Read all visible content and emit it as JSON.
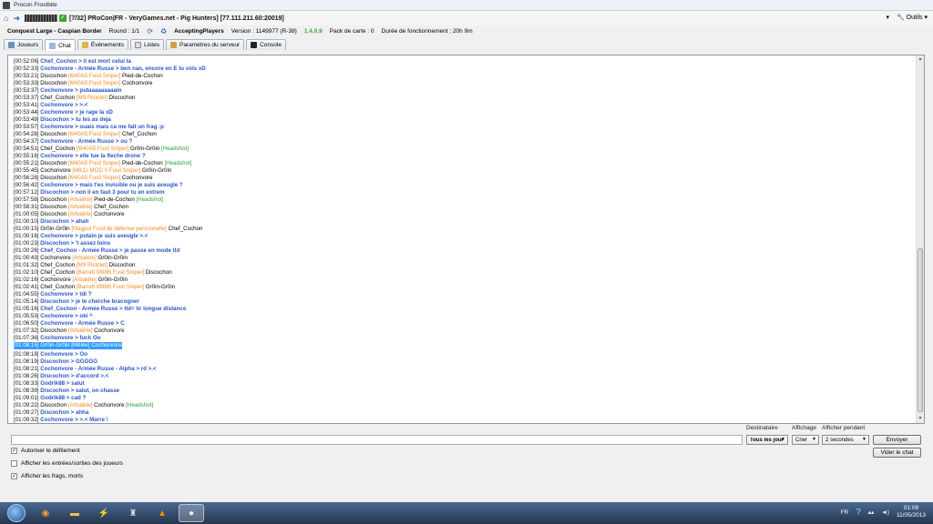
{
  "window": {
    "title": "Procon Frostbite"
  },
  "toolbar": {
    "server_title": "[7/32] PRoCon|FR - VeryGames.net - Pig Hunters] [77.111.211.60:20019]",
    "tools_label": "Outils"
  },
  "info": {
    "map": "Conquest Large - Caspian Border",
    "round": "Round : 1/1",
    "state": "AcceptingPlayers",
    "version_label": "Version : 1149977 (R-38)",
    "procon_version": "1.4.0.9",
    "map_pack": "Pack de carte : 0",
    "uptime": "Durée de fonctionnement : 20h 9m"
  },
  "tabs": [
    {
      "label": "Joueurs",
      "icon": "players-icon"
    },
    {
      "label": "Chat",
      "icon": "chat-icon"
    },
    {
      "label": "Événements",
      "icon": "events-icon"
    },
    {
      "label": "Listes",
      "icon": "lists-icon"
    },
    {
      "label": "Paramètres du serveur",
      "icon": "settings-icon"
    },
    {
      "label": "Console",
      "icon": "console-icon"
    }
  ],
  "chat_lines": [
    {
      "ts": "[00:52:06]",
      "parts": [
        {
          "t": "Chef_Cochon > il est mort celui la",
          "c": "blue"
        }
      ]
    },
    {
      "ts": "[00:52:33]",
      "parts": [
        {
          "t": "Cochonvore - Armée Russe > ben nan, encore en E tu vois xD",
          "c": "blue"
        }
      ]
    },
    {
      "ts": "[00:53:21]",
      "parts": [
        {
          "t": "Discochon ",
          "c": ""
        },
        {
          "t": "[M40A5 Fusil Sniper]",
          "c": "orange"
        },
        {
          "t": " Pied-de-Cochon",
          "c": ""
        }
      ]
    },
    {
      "ts": "[00:53:33]",
      "parts": [
        {
          "t": "Discochon ",
          "c": ""
        },
        {
          "t": "[M40A5 Fusil Sniper]",
          "c": "orange"
        },
        {
          "t": " Cochonvore",
          "c": ""
        }
      ]
    },
    {
      "ts": "[00:53:37]",
      "parts": [
        {
          "t": "Cochonvore > putaaaaaaaaain",
          "c": "blue"
        }
      ]
    },
    {
      "ts": "[00:53:37]",
      "parts": [
        {
          "t": "Chef_Cochon ",
          "c": ""
        },
        {
          "t": "[M9 Pistolet]",
          "c": "orange"
        },
        {
          "t": " Discochon",
          "c": ""
        }
      ]
    },
    {
      "ts": "[00:53:41]",
      "parts": [
        {
          "t": "Cochonvore > >.<",
          "c": "blue"
        }
      ]
    },
    {
      "ts": "[00:53:44]",
      "parts": [
        {
          "t": "Cochonvore > je rage la xD",
          "c": "blue"
        }
      ]
    },
    {
      "ts": "[00:53:49]",
      "parts": [
        {
          "t": "Discochon > tu les as deja",
          "c": "blue"
        }
      ]
    },
    {
      "ts": "[00:53:57]",
      "parts": [
        {
          "t": "Cochonvore > ouais mais ca me fait un frag :p",
          "c": "blue"
        }
      ]
    },
    {
      "ts": "[00:54:28]",
      "parts": [
        {
          "t": "Discochon ",
          "c": ""
        },
        {
          "t": "[M40A5 Fusil Sniper]",
          "c": "orange"
        },
        {
          "t": " Chef_Cochon",
          "c": ""
        }
      ]
    },
    {
      "ts": "[00:54:37]",
      "parts": [
        {
          "t": "Cochonvore - Armée Russe > ou ?",
          "c": "blue"
        }
      ]
    },
    {
      "ts": "[00:54:51]",
      "parts": [
        {
          "t": "Chef_Cochon ",
          "c": ""
        },
        {
          "t": "[M40A5 Fusil Sniper]",
          "c": "orange"
        },
        {
          "t": " Gr0in-Gr0in ",
          "c": ""
        },
        {
          "t": "[Headshot]",
          "c": "green"
        }
      ]
    },
    {
      "ts": "[00:55:16]",
      "parts": [
        {
          "t": "Cochonvore > elle tue la fleche drone ?",
          "c": "blue"
        }
      ]
    },
    {
      "ts": "[00:55:21]",
      "parts": [
        {
          "t": "Discochon ",
          "c": ""
        },
        {
          "t": "[M40A5 Fusil Sniper]",
          "c": "orange"
        },
        {
          "t": " Pied-de-Cochon ",
          "c": ""
        },
        {
          "t": "[Headshot]",
          "c": "green"
        }
      ]
    },
    {
      "ts": "[00:55:45]",
      "parts": [
        {
          "t": "Cochonvore ",
          "c": ""
        },
        {
          "t": "[MK11 MOD 0 Fusil Sniper]",
          "c": "orange"
        },
        {
          "t": " Gr0in-Gr0in",
          "c": ""
        }
      ]
    },
    {
      "ts": "[00:56:28]",
      "parts": [
        {
          "t": "Discochon ",
          "c": ""
        },
        {
          "t": "[M40A5 Fusil Sniper]",
          "c": "orange"
        },
        {
          "t": " Cochonvore",
          "c": ""
        }
      ]
    },
    {
      "ts": "[00:56:42]",
      "parts": [
        {
          "t": "Cochonvore > mais t'es invisible ou je suis aveugle ?",
          "c": "blue"
        }
      ]
    },
    {
      "ts": "[00:57:12]",
      "parts": [
        {
          "t": "Discochon > non il en faut 3 pour tu en extrem",
          "c": "blue"
        }
      ]
    },
    {
      "ts": "[00:57:58]",
      "parts": [
        {
          "t": "Discochon ",
          "c": ""
        },
        {
          "t": "[Arbalète]",
          "c": "orange"
        },
        {
          "t": " Pied-de-Cochon ",
          "c": ""
        },
        {
          "t": "[Headshot]",
          "c": "green"
        }
      ]
    },
    {
      "ts": "[00:58:31]",
      "parts": [
        {
          "t": "Discochon ",
          "c": ""
        },
        {
          "t": "[Arbalète]",
          "c": "orange"
        },
        {
          "t": " Chef_Cochon",
          "c": ""
        }
      ]
    },
    {
      "ts": "[01:00:05]",
      "parts": [
        {
          "t": "Discochon ",
          "c": ""
        },
        {
          "t": "[Arbalète]",
          "c": "orange"
        },
        {
          "t": " Cochonvore",
          "c": ""
        }
      ]
    },
    {
      "ts": "[01:00:10]",
      "parts": [
        {
          "t": "Discochon > ahah",
          "c": "blue"
        }
      ]
    },
    {
      "ts": "[01:00:15]",
      "parts": [
        {
          "t": "Gr0in-Gr0in ",
          "c": ""
        },
        {
          "t": "[Magpul Fusil de défense personnelle]",
          "c": "orange"
        },
        {
          "t": " Chef_Cochon",
          "c": ""
        }
      ]
    },
    {
      "ts": "[01:00:16]",
      "parts": [
        {
          "t": "Cochonvore > putain je suis aveugle >.<",
          "c": "blue"
        }
      ]
    },
    {
      "ts": "[01:00:23]",
      "parts": [
        {
          "t": "Discochon > 't assez loins",
          "c": "blue"
        }
      ]
    },
    {
      "ts": "[01:00:26]",
      "parts": [
        {
          "t": "Chef_Cochon - Armée Russe > je passe en mode tld",
          "c": "blue"
        }
      ]
    },
    {
      "ts": "[01:00:43]",
      "parts": [
        {
          "t": "Cochonvore ",
          "c": ""
        },
        {
          "t": "[Arbalète]",
          "c": "orange"
        },
        {
          "t": " Gr0in-Gr0in",
          "c": ""
        }
      ]
    },
    {
      "ts": "[01:01:32]",
      "parts": [
        {
          "t": "Chef_Cochon ",
          "c": ""
        },
        {
          "t": "[M9 Pistolet]",
          "c": "orange"
        },
        {
          "t": " Discochon",
          "c": ""
        }
      ]
    },
    {
      "ts": "[01:02:10]",
      "parts": [
        {
          "t": "Chef_Cochon ",
          "c": ""
        },
        {
          "t": "[Barrett M98B Fusil Sniper]",
          "c": "orange"
        },
        {
          "t": " Discochon",
          "c": ""
        }
      ]
    },
    {
      "ts": "[01:02:16]",
      "parts": [
        {
          "t": "Cochonvore ",
          "c": ""
        },
        {
          "t": "[Arbalète]",
          "c": "orange"
        },
        {
          "t": " Gr0in-Gr0in",
          "c": ""
        }
      ]
    },
    {
      "ts": "[01:02:41]",
      "parts": [
        {
          "t": "Chef_Cochon ",
          "c": ""
        },
        {
          "t": "[Barrett M98B Fusil Sniper]",
          "c": "orange"
        },
        {
          "t": " Gr0in-Gr0in",
          "c": ""
        }
      ]
    },
    {
      "ts": "[01:04:55]",
      "parts": [
        {
          "t": "Cochonvore > tdl ?",
          "c": "blue"
        }
      ]
    },
    {
      "ts": "[01:05:14]",
      "parts": [
        {
          "t": "Discochon > je te cherche bracogner",
          "c": "blue"
        }
      ]
    },
    {
      "ts": "[01:05:16]",
      "parts": [
        {
          "t": "Chef_Cochon - Armée Russe > tld= tir longue distance",
          "c": "blue"
        }
      ]
    },
    {
      "ts": "[01:05:53]",
      "parts": [
        {
          "t": "Cochonvore > oki ^",
          "c": "blue"
        }
      ]
    },
    {
      "ts": "[01:06:50]",
      "parts": [
        {
          "t": "Cochonvore - Armée Russe > C",
          "c": "blue"
        }
      ]
    },
    {
      "ts": "[01:07:32]",
      "parts": [
        {
          "t": "Discochon ",
          "c": ""
        },
        {
          "t": "[Arbalète]",
          "c": "orange"
        },
        {
          "t": " Cochonvore",
          "c": ""
        }
      ]
    },
    {
      "ts": "[01:07:36]",
      "parts": [
        {
          "t": "Cochonvore > fuck Oo",
          "c": "blue"
        }
      ]
    },
    {
      "ts": "[01:08:15]",
      "selected": true,
      "parts": [
        {
          "t": "Gr0in-Gr0in [Mêlée]  Cochonvore",
          "c": ""
        }
      ]
    },
    {
      "ts": "[01:08:18]",
      "parts": [
        {
          "t": "Cochonvore > Oo",
          "c": "blue"
        }
      ]
    },
    {
      "ts": "[01:08:19]",
      "parts": [
        {
          "t": "Discochon > GGGGG",
          "c": "blue"
        }
      ]
    },
    {
      "ts": "[01:08:21]",
      "parts": [
        {
          "t": "Cochonvore - Armée Russe - Alpha > rd >.<",
          "c": "blue"
        }
      ]
    },
    {
      "ts": "[01:08:26]",
      "parts": [
        {
          "t": "Discochon > d'accord >.<",
          "c": "blue"
        }
      ]
    },
    {
      "ts": "[01:08:33]",
      "parts": [
        {
          "t": "Godrik88 > salut",
          "c": "blue"
        }
      ]
    },
    {
      "ts": "[01:08:39]",
      "parts": [
        {
          "t": "Discochon > salut, on chasse",
          "c": "blue"
        }
      ]
    },
    {
      "ts": "[01:09:01]",
      "parts": [
        {
          "t": "Godrik88 > cad ?",
          "c": "blue"
        }
      ]
    },
    {
      "ts": "[01:09:22]",
      "parts": [
        {
          "t": "Discochon ",
          "c": ""
        },
        {
          "t": "[Arbalète]",
          "c": "orange"
        },
        {
          "t": " Cochonvore ",
          "c": ""
        },
        {
          "t": "[Headshot]",
          "c": "green"
        }
      ]
    },
    {
      "ts": "[01:09:27]",
      "parts": [
        {
          "t": "Discochon > ahha",
          "c": "blue"
        }
      ]
    },
    {
      "ts": "[01:09:32]",
      "parts": [
        {
          "t": "Cochonvore > >.< Marre !",
          "c": "blue"
        }
      ]
    }
  ],
  "controls": {
    "recipient_label": "Destinataire",
    "recipient_value": "Tous les joueurs",
    "display_label": "Affichage",
    "display_value": "Crier",
    "duration_label": "Afficher pendant",
    "duration_value": "2 secondes",
    "send_button": "Envoyer",
    "clear_button": "Vider le chat",
    "message_value": ""
  },
  "options": [
    {
      "label": "Autoriser le défilement",
      "checked": true
    },
    {
      "label": "Afficher les entrées/sorties des joueurs",
      "checked": false
    },
    {
      "label": "Afficher les frags, morts",
      "checked": true
    }
  ],
  "taskbar": {
    "language": "FR",
    "time": "01:09",
    "date": "11/05/2013"
  },
  "colors": {
    "chat_blue": "#2a55c8",
    "weapon_orange": "#f08b24",
    "headshot_green": "#2aa13a",
    "selection": "#3399ff"
  }
}
